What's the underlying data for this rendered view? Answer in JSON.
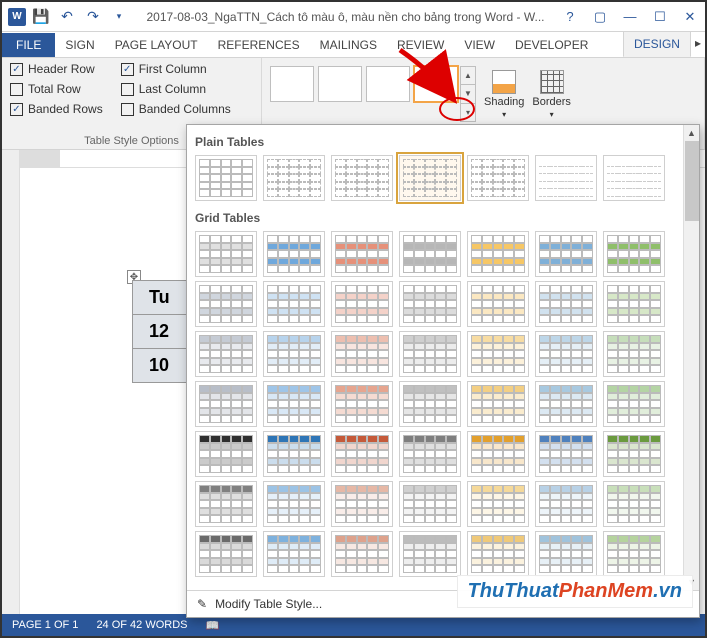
{
  "titlebar": {
    "title": "2017-08-03_NgaTTN_Cách tô màu ô, màu nền cho bảng trong Word - W..."
  },
  "ribbon": {
    "file": "FILE",
    "tabs": [
      "SIGN",
      "PAGE LAYOUT",
      "REFERENCES",
      "MAILINGS",
      "REVIEW",
      "VIEW",
      "DEVELOPER"
    ],
    "context_tab": "DESIGN",
    "groups": {
      "tsopt_title": "Table Style Options",
      "checks": {
        "header_row": "Header Row",
        "total_row": "Total Row",
        "banded_rows": "Banded Rows",
        "first_col": "First Column",
        "last_col": "Last Column",
        "banded_cols": "Banded Columns"
      },
      "shading": "Shading",
      "borders": "Borders"
    }
  },
  "panel": {
    "sect_plain": "Plain Tables",
    "sect_grid": "Grid Tables",
    "modify": "Modify Table Style..."
  },
  "doc": {
    "table": {
      "h1": "Tu",
      "r1": "12",
      "r2": "10"
    }
  },
  "status": {
    "page": "PAGE 1 OF 1",
    "words": "24 OF 42 WORDS"
  },
  "watermark": {
    "a": "ThuThuat",
    "b": "PhanMem",
    "c": ".vn"
  },
  "grid_colors": [
    [
      "#e0e0e0",
      "#6fa8dc",
      "#e6917a",
      "#b6b6b6",
      "#f6c766",
      "#7fb0d8",
      "#8fbf6a",
      "#e6917a"
    ],
    [
      "#d0d6de",
      "#cfe2f3",
      "#f4d2c9",
      "#dcdcdc",
      "#fbe8c2",
      "#d1e2ef",
      "#d7e8c8",
      "#f4d2c9"
    ],
    [
      "#c5cbd4",
      "#b7d3ec",
      "#edbfb0",
      "#cfcfcf",
      "#f7dca3",
      "#bdd6e8",
      "#c6debb",
      "#edbfb0"
    ],
    [
      "#b8bec8",
      "#9fc5e8",
      "#e6a58f",
      "#c0c0c0",
      "#f3cf84",
      "#a8c9e0",
      "#b4d4a4",
      "#e6a58f"
    ],
    [
      "#2f2f2f",
      "#2e75b6",
      "#c55a3a",
      "#7f7f7f",
      "#e2a02e",
      "#4f81bd",
      "#6a9a3e",
      "#c55a3a"
    ],
    [
      "#808080",
      "#9cc3e5",
      "#e6b8a6",
      "#d0d0d0",
      "#f5d99a",
      "#b8d1e6",
      "#c8dfba",
      "#e6b8a6"
    ],
    [
      "#6a6a6a",
      "#7eb1dd",
      "#dea28c",
      "#bcbcbc",
      "#efc97a",
      "#a0c3dc",
      "#b5d39e",
      "#dea28c"
    ]
  ]
}
